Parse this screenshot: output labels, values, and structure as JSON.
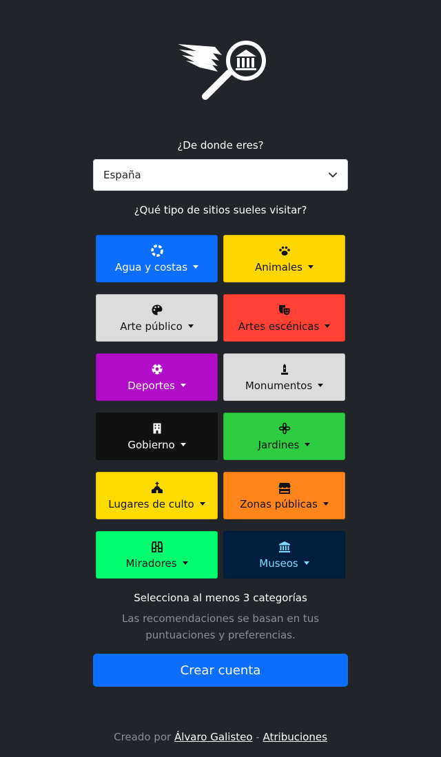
{
  "question_origin": "¿De donde eres?",
  "country_select": {
    "value": "España"
  },
  "question_types": "¿Qué tipo de sitios sueles visitar?",
  "categories": [
    {
      "label": "Agua y costas",
      "icon": "life-ring-icon",
      "bg": "#0d6efd",
      "fg": "#ffffff"
    },
    {
      "label": "Animales",
      "icon": "paw-icon",
      "bg": "#ffd700",
      "fg": "#111111"
    },
    {
      "label": "Arte público",
      "icon": "palette-icon",
      "bg": "#dcdcdc",
      "fg": "#111111"
    },
    {
      "label": "Artes escénicas",
      "icon": "theater-masks-icon",
      "bg": "#ff4136",
      "fg": "#111111"
    },
    {
      "label": "Deportes",
      "icon": "soccer-ball-icon",
      "bg": "#b10dc9",
      "fg": "#ffffff"
    },
    {
      "label": "Monumentos",
      "icon": "monument-icon",
      "bg": "#dcdcdc",
      "fg": "#111111"
    },
    {
      "label": "Gobierno",
      "icon": "building-icon",
      "bg": "#111111",
      "fg": "#ffffff"
    },
    {
      "label": "Jardines",
      "icon": "flower-icon",
      "bg": "#2ecc40",
      "fg": "#111111"
    },
    {
      "label": "Lugares de culto",
      "icon": "church-icon",
      "bg": "#ffdc00",
      "fg": "#111111"
    },
    {
      "label": "Zonas públicas",
      "icon": "store-icon",
      "bg": "#ff851b",
      "fg": "#111111"
    },
    {
      "label": "Miradores",
      "icon": "binoculars-icon",
      "bg": "#01ff70",
      "fg": "#111111"
    },
    {
      "label": "Museos",
      "icon": "landmark-icon",
      "bg": "#001f3f",
      "fg": "#7fdbff"
    }
  ],
  "note_min": "Selecciona al menos 3 categorías",
  "note_info": "Las recomendaciones se basan en tus puntuaciones y preferencias.",
  "submit_label": "Crear cuenta",
  "footer": {
    "prefix": "Creado por",
    "author": "Álvaro Galisteo",
    "separator": "-",
    "attributions": "Atribuciones"
  }
}
